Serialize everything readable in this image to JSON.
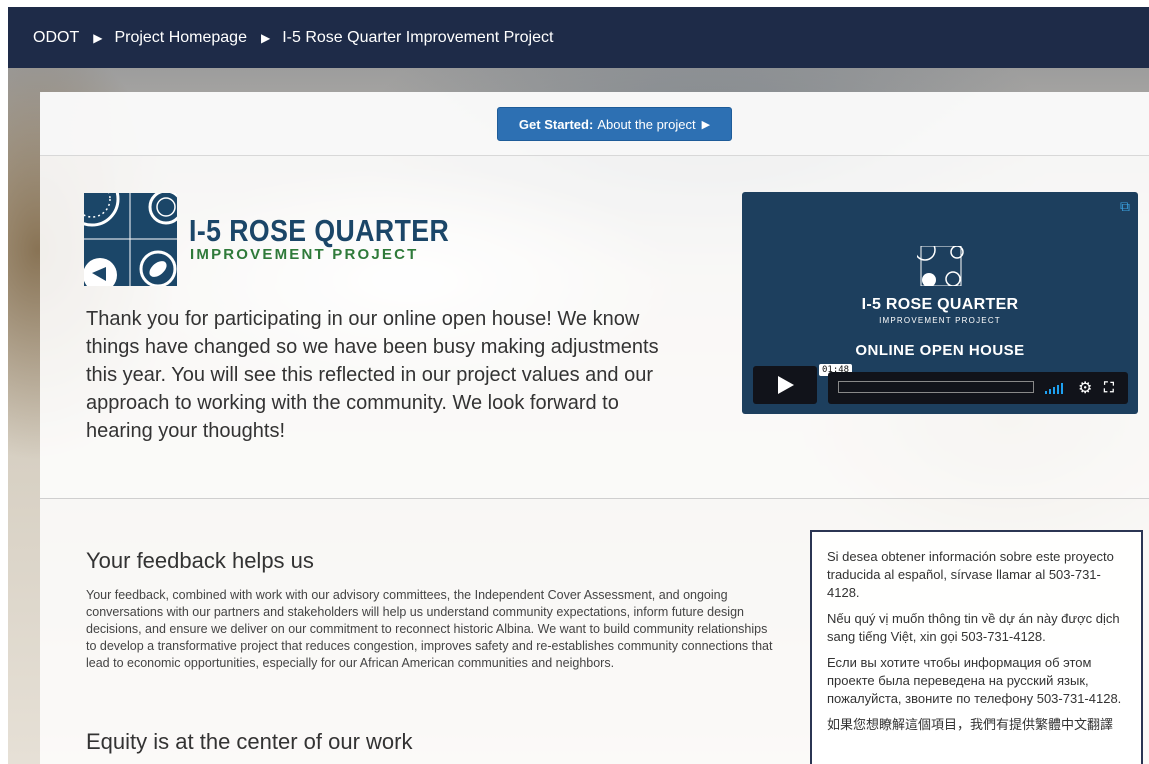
{
  "breadcrumb": {
    "items": [
      "ODOT",
      "Project Homepage",
      "I-5 Rose Quarter Improvement Project"
    ]
  },
  "get_started": {
    "bold": "Get Started:",
    "rest": "About the project"
  },
  "logo": {
    "title": "I-5 ROSE QUARTER",
    "subtitle": "IMPROVEMENT PROJECT"
  },
  "intro_text": "Thank you for participating in our online open house! We know things have changed so we have been busy making adjustments this year. You will see this reflected in our project values and our approach to working with the community. We look forward to hearing your thoughts!",
  "video": {
    "title": "I-5 ROSE QUARTER",
    "subtitle": "IMPROVEMENT PROJECT",
    "caption": "ONLINE OPEN HOUSE",
    "duration": "01:48"
  },
  "feedback": {
    "title": "Your feedback helps us",
    "body": "Your feedback, combined with work with our advisory committees, the Independent Cover Assessment, and ongoing conversations with our partners and stakeholders will help us understand community expectations, inform future design decisions, and ensure we deliver on our commitment to reconnect historic Albina. We want to build community relationships to develop a transformative project that reduces congestion, improves safety and re-establishes community connections that lead to economic opportunities, especially for our African American communities and neighbors."
  },
  "equity": {
    "title": "Equity is at the center of our work"
  },
  "languages": [
    "Si desea obtener información sobre este proyecto traducida al español, sírvase llamar al 503-731-4128.",
    "Nếu quý vị muốn thông tin về dự án này được dịch sang tiếng Việt, xin gọi 503-731-4128.",
    "Если вы хотите чтобы информация об этом проекте была переведена на русский язык, пожалуйста, звоните по телефону 503-731-4128.",
    "如果您想瞭解這個項目，我們有提供繁體中文翻譯"
  ],
  "colors": {
    "topbar": "#1e2b48",
    "button": "#2d70b3",
    "logo_blue": "#1b4668",
    "logo_green": "#2f7a3a",
    "video_bg": "#1d3f5e",
    "volume": "#1ea1f1"
  }
}
